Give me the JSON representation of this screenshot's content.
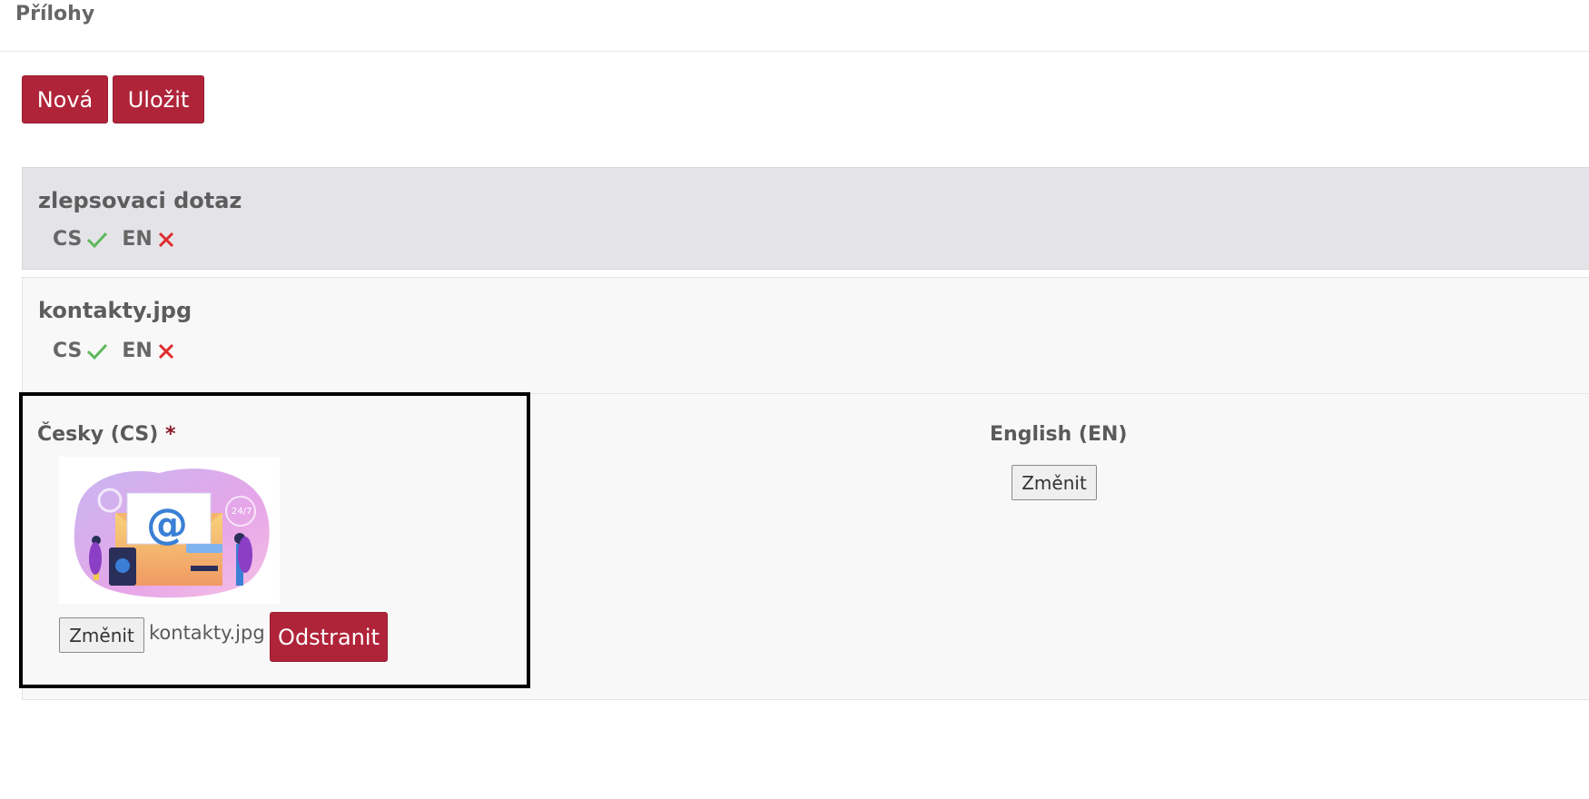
{
  "section": {
    "title": "Přílohy"
  },
  "toolbar": {
    "new_label": "Nová",
    "save_label": "Uložit"
  },
  "attachments": [
    {
      "title": "zlepsovaci dotaz",
      "languages": [
        {
          "code": "CS",
          "status_icon": "check-icon",
          "status_color": "#5cb85c"
        },
        {
          "code": "EN",
          "status_icon": "cross-icon",
          "status_color": "#e02b2b"
        }
      ]
    },
    {
      "title": "kontakty.jpg",
      "languages": [
        {
          "code": "CS",
          "status_icon": "check-icon",
          "status_color": "#5cb85c"
        },
        {
          "code": "EN",
          "status_icon": "cross-icon",
          "status_color": "#e02b2b"
        }
      ]
    }
  ],
  "editor": {
    "cs": {
      "label": "Česky (CS)",
      "required_mark": "*",
      "image": "contacts-illustration",
      "change_label": "Změnit",
      "file_name": "kontakty.jpg",
      "remove_label": "Odstranit"
    },
    "en": {
      "label": "English (EN)",
      "change_label": "Změnit"
    }
  },
  "colors": {
    "accent": "#b0243a",
    "check": "#5cb85c",
    "cross": "#e02b2b"
  }
}
